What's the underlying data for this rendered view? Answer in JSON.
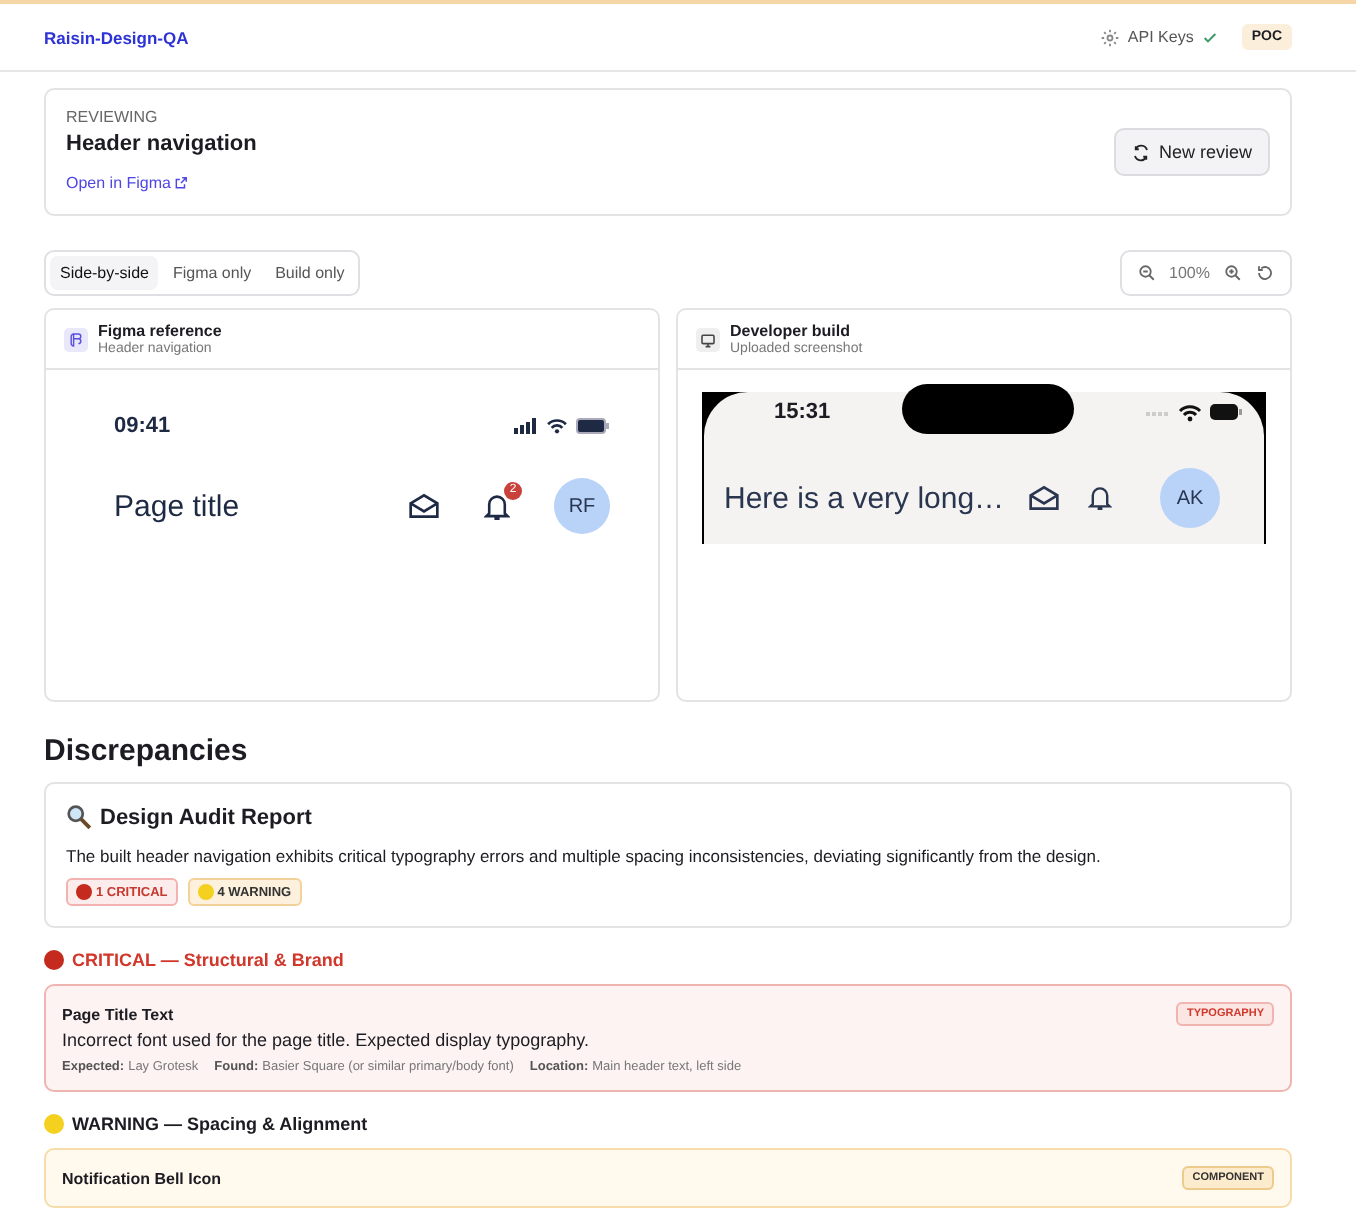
{
  "header": {
    "brand": "Raisin-Design-QA",
    "api_keys": {
      "label": "API Keys",
      "connected": true
    },
    "badge": "POC"
  },
  "review": {
    "eyebrow": "REVIEWING",
    "title": "Header navigation",
    "link": "Open in Figma",
    "button": "New review"
  },
  "view_modes": [
    {
      "label": "Side-by-side",
      "selected": true
    },
    {
      "label": "Figma only",
      "selected": false
    },
    {
      "label": "Build only",
      "selected": false
    }
  ],
  "zoom": {
    "level_text": "100%"
  },
  "panels": [
    {
      "kind": "figma",
      "title": "Figma reference",
      "subtitle": "Header navigation",
      "time": "09:41",
      "page_title": "Page title",
      "notification_count": "2",
      "avatar": "RF"
    },
    {
      "kind": "build",
      "title": "Developer build",
      "subtitle": "Uploaded screenshot",
      "time": "15:31",
      "page_title": "Here is a very long…",
      "avatar": "AK"
    }
  ],
  "discrepancies": {
    "title": "Discrepancies",
    "report": {
      "title": "Design Audit Report",
      "summary": "The built header navigation exhibits critical typography errors and multiple spacing inconsistencies, deviating significantly from the design.",
      "counts": [
        {
          "kind": "critical",
          "label": "1 CRITICAL"
        },
        {
          "kind": "warning",
          "label": "4 WARNING"
        }
      ]
    },
    "groups": [
      {
        "kind": "critical",
        "heading": "CRITICAL — Structural & Brand",
        "issues": [
          {
            "title": "Page Title Text",
            "category": "TYPOGRAPHY",
            "description": "Incorrect font used for the page title. Expected display typography.",
            "details": [
              {
                "label": "Expected:",
                "value": "Lay Grotesk"
              },
              {
                "label": "Found:",
                "value": "Basier Square (or similar primary/body font)"
              },
              {
                "label": "Location:",
                "value": "Main header text, left side"
              }
            ]
          }
        ]
      },
      {
        "kind": "warning",
        "heading": "WARNING — Spacing & Alignment",
        "issues": [
          {
            "title": "Notification Bell Icon",
            "category": "COMPONENT"
          }
        ]
      }
    ]
  }
}
